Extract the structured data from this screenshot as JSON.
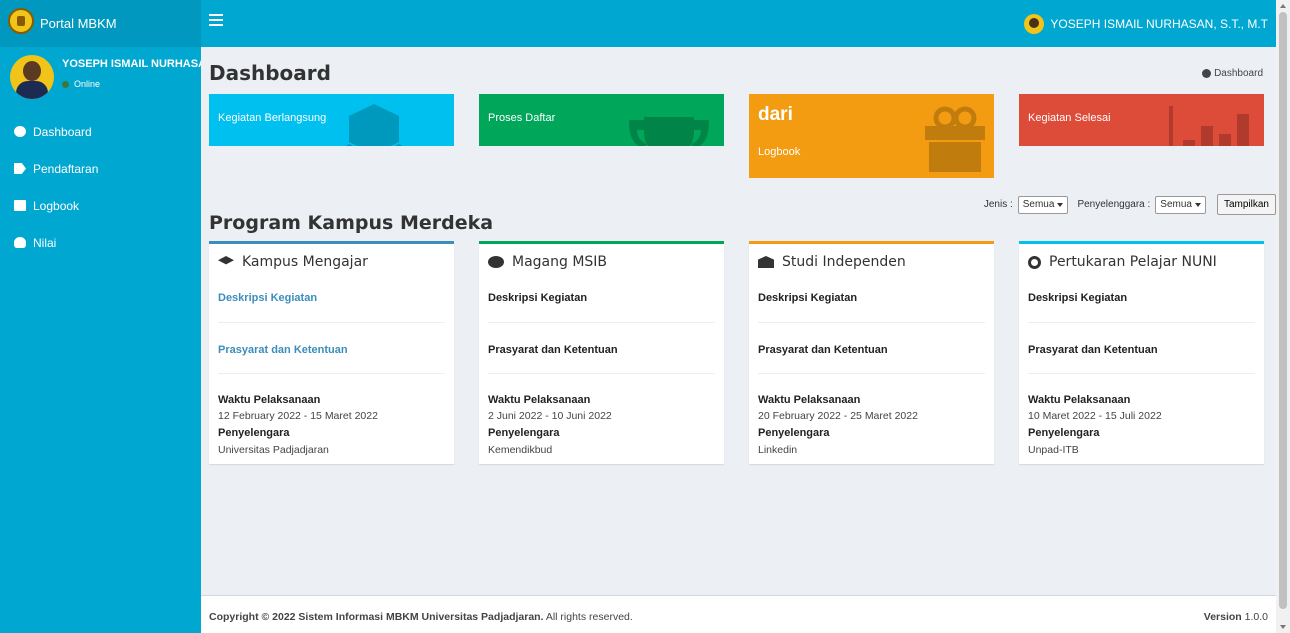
{
  "app": {
    "name": "Portal MBKM"
  },
  "topbar": {
    "user": "YOSEPH ISMAIL NURHASAN, S.T., M.T"
  },
  "sidebar": {
    "user_name": "YOSEPH ISMAIL NURHASAN",
    "status": "Online",
    "items": [
      {
        "label": "Dashboard",
        "icon": "dashboard-icon"
      },
      {
        "label": "Pendaftaran",
        "icon": "tag-icon"
      },
      {
        "label": "Logbook",
        "icon": "book-icon"
      },
      {
        "label": "Nilai",
        "icon": "users-icon"
      }
    ]
  },
  "page": {
    "title": "Dashboard",
    "breadcrumb": "Dashboard"
  },
  "stat_boxes": [
    {
      "label": "Kegiatan Berlangsung",
      "color": "#00c0ef",
      "icon": "cubes-icon"
    },
    {
      "label": "Proses Daftar",
      "color": "#00a65a",
      "icon": "trophy-icon"
    },
    {
      "value": "dari",
      "label": "Logbook",
      "color": "#f39c12",
      "icon": "gift-icon"
    },
    {
      "label": "Kegiatan Selesai",
      "color": "#dd4b39",
      "icon": "bar-chart-icon"
    }
  ],
  "filters": {
    "jenis_label": "Jenis :",
    "jenis_value": "Semua",
    "penyelenggara_label": "Penyelenggara :",
    "penyelenggara_value": "Semua",
    "button": "Tampilkan"
  },
  "section": {
    "title": "Program Kampus Merdeka"
  },
  "programs": [
    {
      "title": "Kampus Mengajar",
      "icon": "graduation-cap-icon",
      "color": "#3c8dbc",
      "deskripsi": "Deskripsi Kegiatan",
      "prasyarat": "Prasyarat dan Ketentuan",
      "waktu_label": "Waktu Pelaksanaan",
      "waktu": "12 February 2022 - 15 Maret 2022",
      "penyelenggara_label": "Penyelengara",
      "penyelenggara": "Universitas Padjadjaran"
    },
    {
      "title": "Magang MSIB",
      "icon": "cogs-icon",
      "color": "#00a65a",
      "deskripsi": "Deskripsi Kegiatan",
      "prasyarat": "Prasyarat dan Ketentuan",
      "waktu_label": "Waktu Pelaksanaan",
      "waktu": "2 Juni 2022 - 10 Juni 2022",
      "penyelenggara_label": "Penyelengara",
      "penyelenggara": "Kemendikbud"
    },
    {
      "title": "Studi Independen",
      "icon": "institution-icon",
      "color": "#f39c12",
      "deskripsi": "Deskripsi Kegiatan",
      "prasyarat": "Prasyarat dan Ketentuan",
      "waktu_label": "Waktu Pelaksanaan",
      "waktu": "20 February 2022 - 25 Maret 2022",
      "penyelenggara_label": "Penyelengara",
      "penyelenggara": "Linkedin"
    },
    {
      "title": "Pertukaran Pelajar NUNI",
      "icon": "refresh-icon",
      "color": "#00c0ef",
      "deskripsi": "Deskripsi Kegiatan",
      "prasyarat": "Prasyarat dan Ketentuan",
      "waktu_label": "Waktu Pelaksanaan",
      "waktu": "10 Maret 2022 - 15 Juli 2022",
      "penyelenggara_label": "Penyelengara",
      "penyelenggara": "Unpad-ITB"
    }
  ],
  "footer": {
    "copyright": "Copyright © 2022 Sistem Informasi MBKM Universitas Padjadjaran.",
    "rights": " All rights reserved.",
    "version_label": "Version",
    "version": "1.0.0"
  }
}
